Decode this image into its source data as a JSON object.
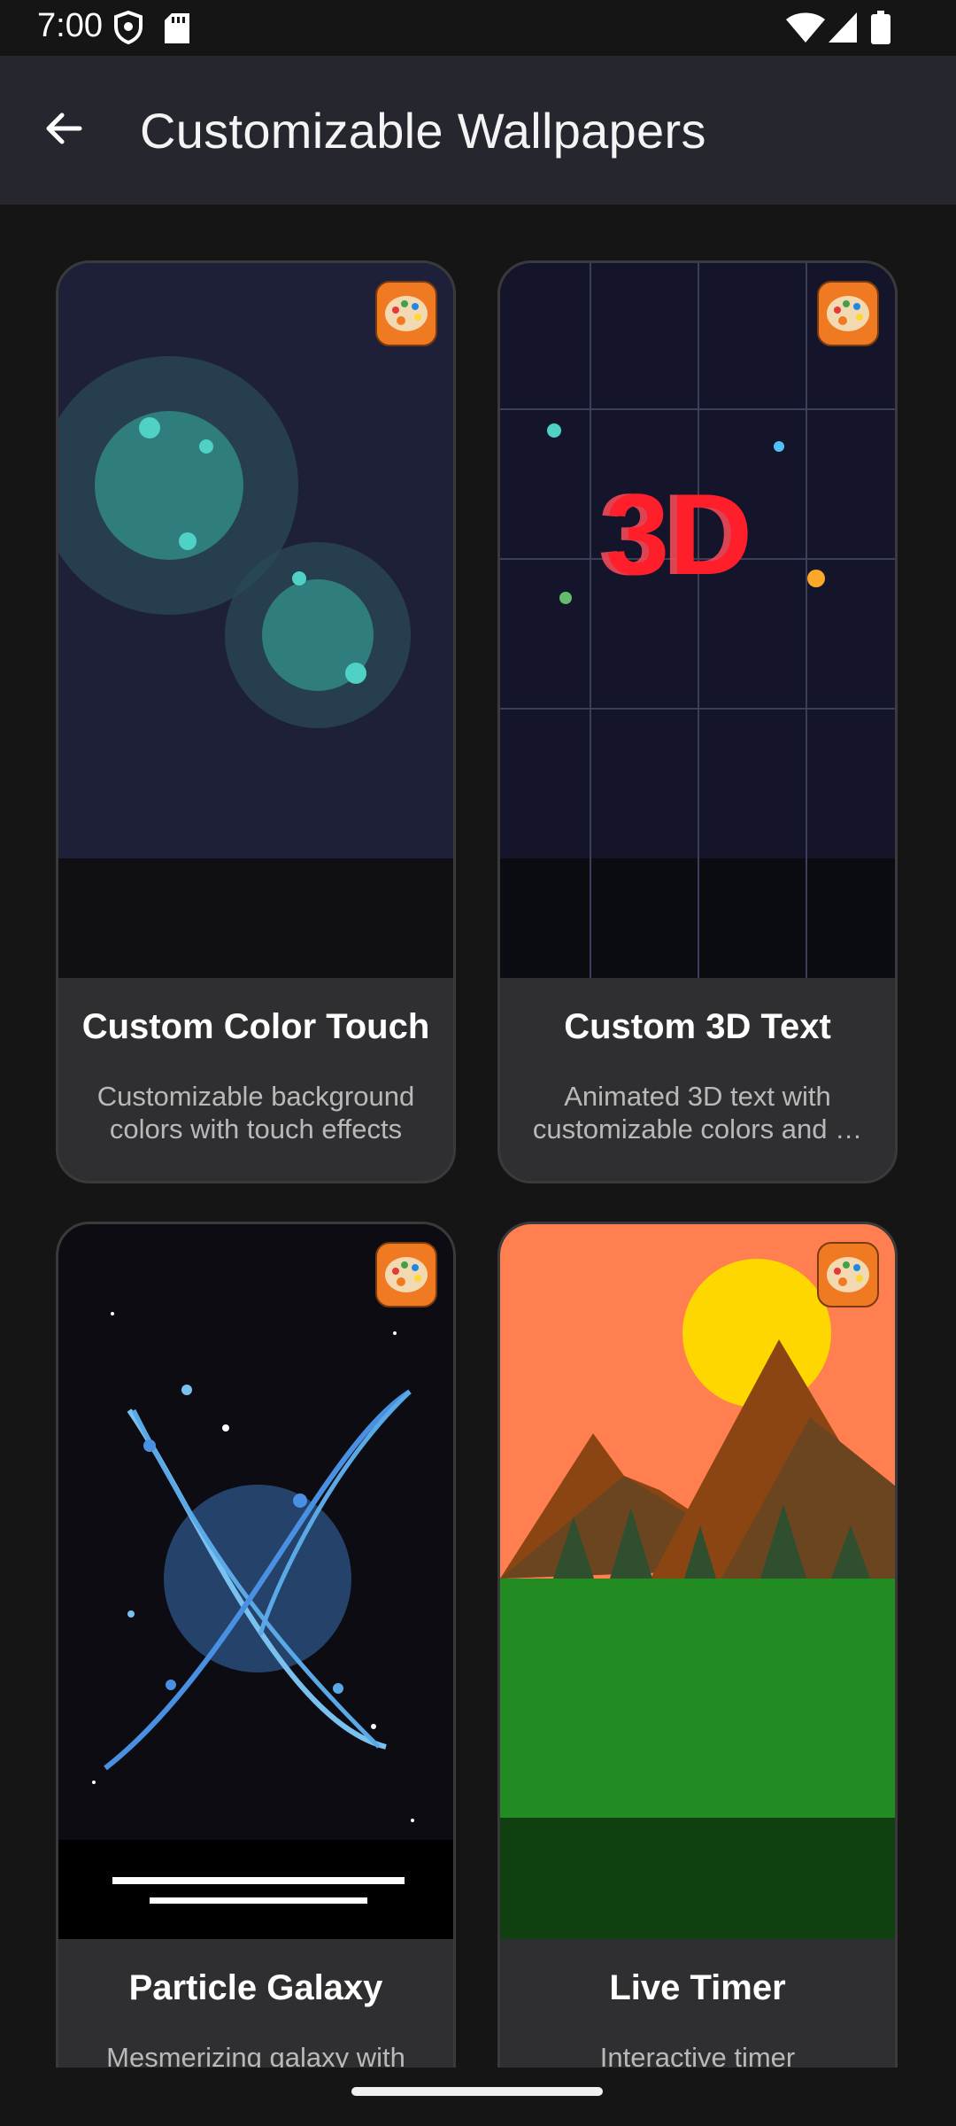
{
  "status_bar": {
    "time": "7:00",
    "icons": [
      "shield-icon",
      "sd-card-icon",
      "wifi-icon",
      "signal-icon",
      "battery-icon"
    ]
  },
  "app_bar": {
    "back_icon": "arrow-left-icon",
    "title": "Customizable Wallpapers"
  },
  "cards": [
    {
      "title": "Custom Color Touch",
      "description": "Customizable background colors with touch effects",
      "badge_icon": "palette-icon"
    },
    {
      "title": "Custom 3D Text",
      "description": "Animated 3D text with customizable colors and …",
      "preview_text": "3D",
      "badge_icon": "palette-icon"
    },
    {
      "title": "Particle Galaxy",
      "description": "Mesmerizing galaxy with",
      "badge_icon": "palette-icon"
    },
    {
      "title": "Live Timer",
      "description": "Interactive timer",
      "badge_icon": "palette-icon"
    }
  ],
  "colors": {
    "background": "#151515",
    "app_bar": "#25262e",
    "card": "#2f2f31",
    "badge": "#f07a22"
  }
}
